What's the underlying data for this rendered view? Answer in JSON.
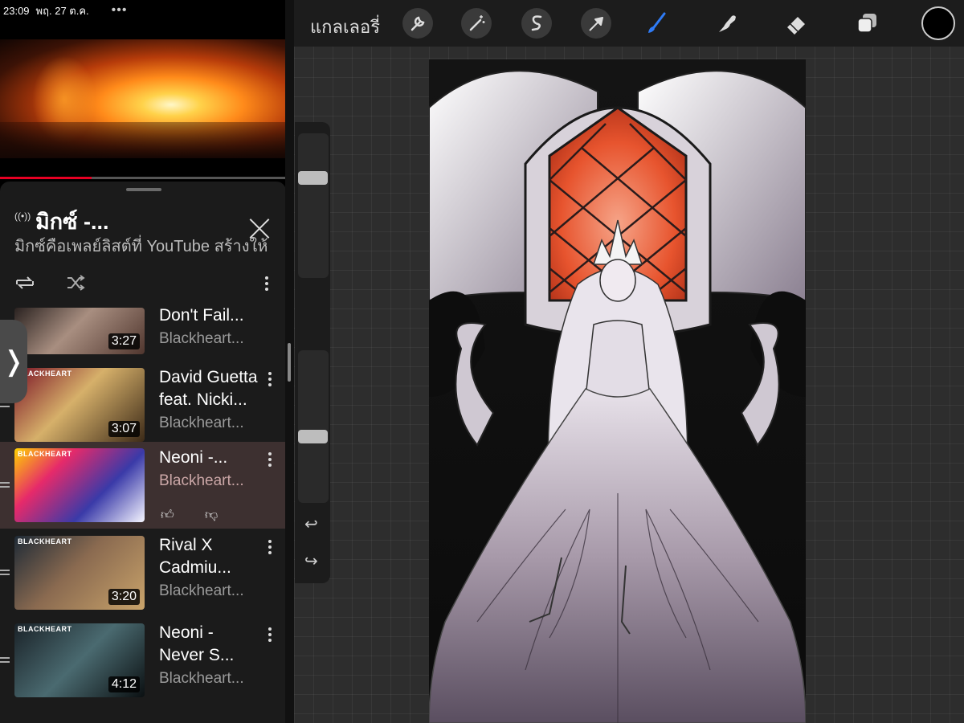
{
  "status_bar": {
    "time": "23:09",
    "date": "พฤ. 27 ต.ค.",
    "dots": "•••"
  },
  "player": {
    "progress": 0.32
  },
  "mix": {
    "title": "มิกซ์ -...",
    "subtitle": "มิกซ์คือเพลย์ลิสต์ที่ YouTube สร้างให้"
  },
  "playlist": [
    {
      "title_line1": "Don't Fail...",
      "title_line2": "",
      "channel": "Blackheart...",
      "duration": "3:27",
      "brand": "",
      "active": false
    },
    {
      "title_line1": "David Guetta",
      "title_line2": "feat. Nicki...",
      "channel": "Blackheart...",
      "duration": "3:07",
      "brand": "BLACKHEART",
      "active": false
    },
    {
      "title_line1": "Neoni -...",
      "title_line2": "",
      "channel": "Blackheart...",
      "duration": "",
      "brand": "BLACKHEART",
      "active": true
    },
    {
      "title_line1": "Rival X",
      "title_line2": "Cadmiu...",
      "channel": "Blackheart...",
      "duration": "3:20",
      "brand": "BLACKHEART",
      "active": false
    },
    {
      "title_line1": "Neoni -",
      "title_line2": "Never S...",
      "channel": "Blackheart...",
      "duration": "4:12",
      "brand": "BLACKHEART",
      "active": false
    }
  ],
  "procreate": {
    "gallery_label": "แกลเลอรี่",
    "tools": [
      "wrench-icon",
      "magic-wand-icon",
      "selection-icon",
      "transform-icon",
      "brush-icon",
      "smudge-icon",
      "eraser-icon",
      "layers-icon"
    ],
    "active_tool": "brush-icon",
    "active_color": "#000000",
    "accent": "#2f7bf5"
  }
}
